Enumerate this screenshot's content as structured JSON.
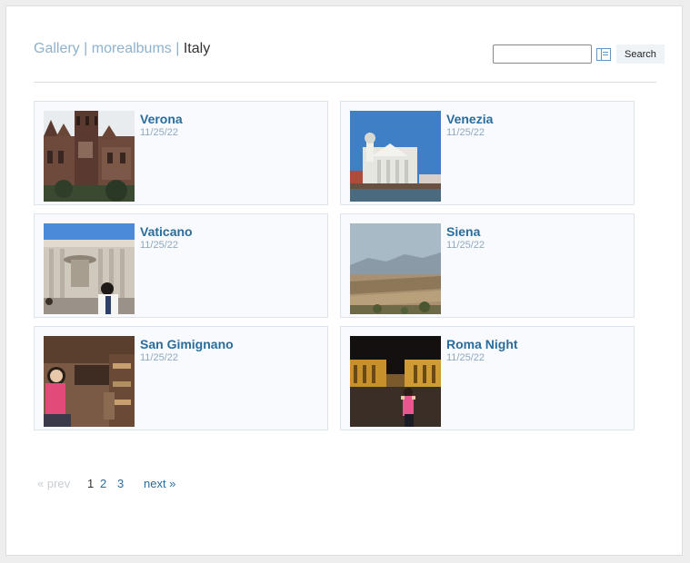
{
  "breadcrumb": {
    "gallery": "Gallery",
    "separator": "|",
    "albums": "morealbums",
    "current": "Italy"
  },
  "search": {
    "value": "",
    "button_label": "Search",
    "options_icon": "search-options-icon"
  },
  "albums": [
    {
      "title": "Verona",
      "date": "11/25/22"
    },
    {
      "title": "Venezia",
      "date": "11/25/22"
    },
    {
      "title": "Vaticano",
      "date": "11/25/22"
    },
    {
      "title": "Siena",
      "date": "11/25/22"
    },
    {
      "title": "San Gimignano",
      "date": "11/25/22"
    },
    {
      "title": "Roma Night",
      "date": "11/25/22"
    }
  ],
  "pagination": {
    "prev": "« prev",
    "pages": [
      "1",
      "2",
      "3"
    ],
    "current_page": "1",
    "next": "next »"
  },
  "colors": {
    "link": "#2a6c9b",
    "breadcrumb_link": "#8cb2cf",
    "date": "#8fa9c0",
    "card_bg": "#f8fafd"
  }
}
